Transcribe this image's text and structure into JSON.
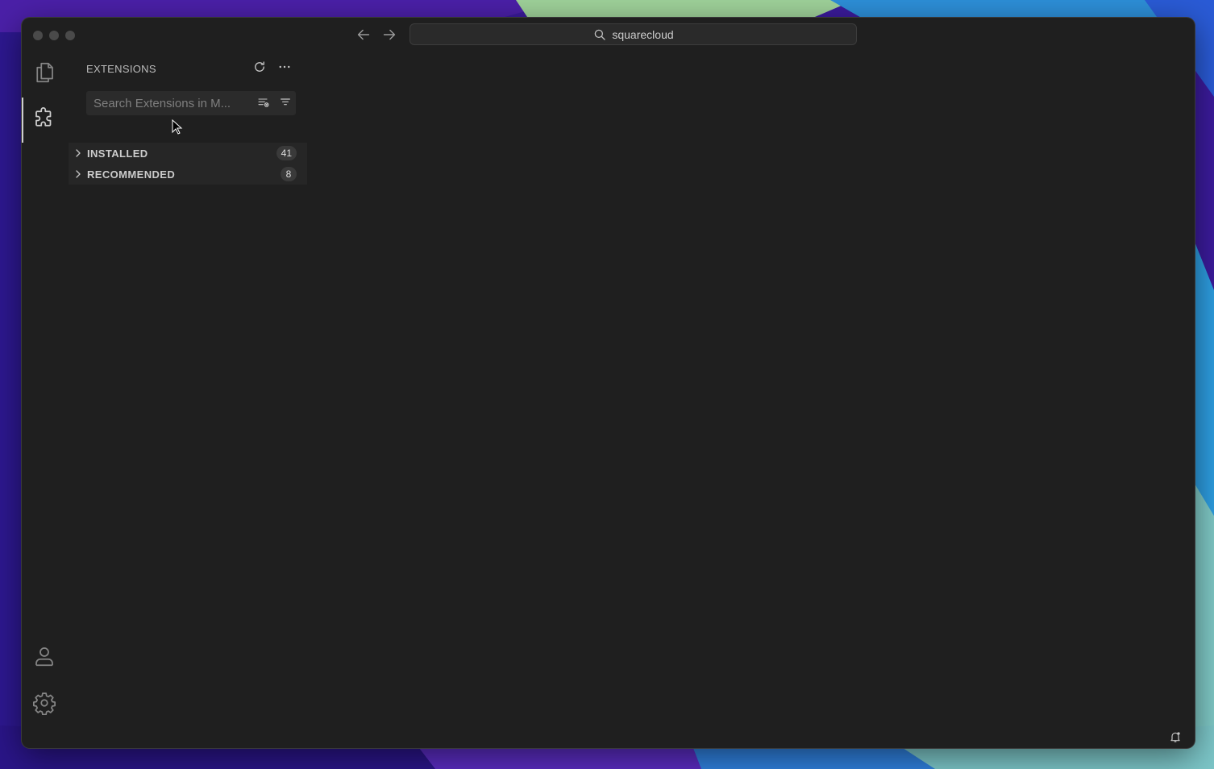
{
  "titlebar": {
    "back_icon": "arrow-left-icon",
    "forward_icon": "arrow-right-icon",
    "command_center_text": "squarecloud"
  },
  "activity_bar": {
    "items": [
      {
        "name": "explorer",
        "icon": "files-icon",
        "active": false
      },
      {
        "name": "extensions",
        "icon": "extensions-icon",
        "active": true
      }
    ],
    "bottom": [
      {
        "name": "accounts",
        "icon": "account-icon"
      },
      {
        "name": "manage",
        "icon": "gear-icon"
      }
    ]
  },
  "sidebar": {
    "title": "EXTENSIONS",
    "actions": [
      {
        "name": "refresh",
        "icon": "refresh-icon"
      },
      {
        "name": "more",
        "icon": "more-icon"
      }
    ],
    "search": {
      "placeholder": "Search Extensions in M...",
      "value": ""
    },
    "sections": [
      {
        "label": "INSTALLED",
        "count": "41",
        "expanded": false
      },
      {
        "label": "RECOMMENDED",
        "count": "8",
        "expanded": false
      }
    ]
  },
  "status": {
    "notifications_icon": "bell-icon"
  },
  "colors": {
    "window_bg": "#1f1f1f",
    "section_bg": "#262626",
    "badge_bg": "#3a3a3a",
    "text": "#cccccc"
  }
}
